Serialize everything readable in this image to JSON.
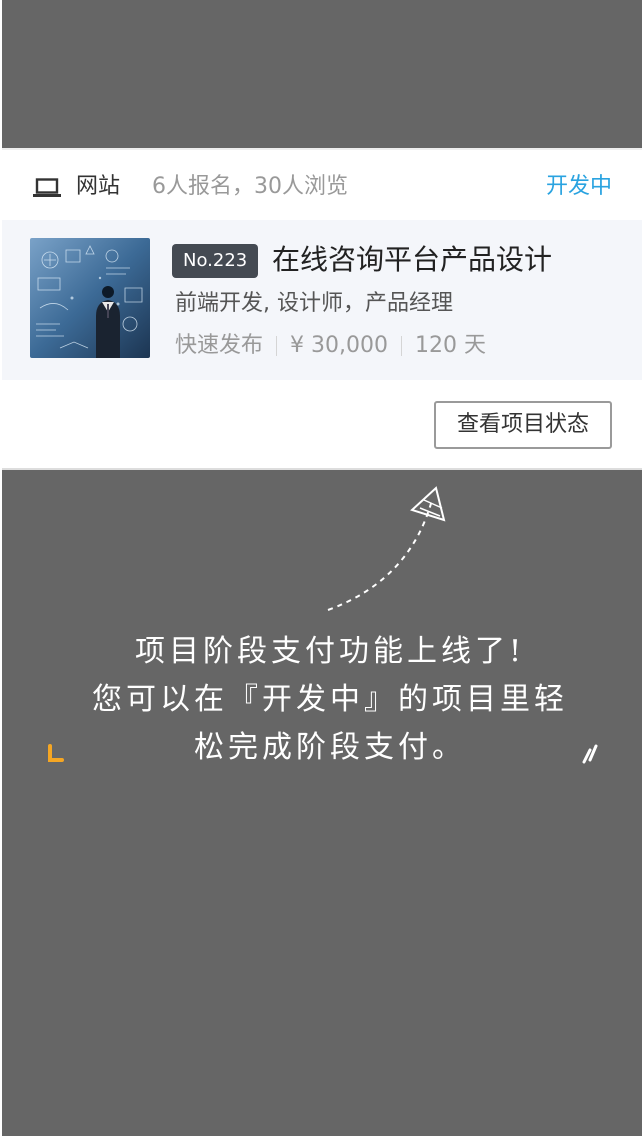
{
  "card": {
    "category": "网站",
    "stats": "6人报名，30人浏览",
    "status": "开发中",
    "project": {
      "number": "No.223",
      "title": "在线咨询平台产品设计",
      "roles": "前端开发, 设计师，产品经理",
      "publish_type": "快速发布",
      "price": "¥ 30,000",
      "duration": "120 天"
    },
    "view_button": "查看项目状态"
  },
  "announcement": {
    "line1": "项目阶段支付功能上线了!",
    "line2": "您可以在『开发中』的项目里轻",
    "line3": "松完成阶段支付。"
  },
  "icons": {
    "category_icon": "laptop-icon",
    "arrow": "dashed-arrow-icon"
  },
  "colors": {
    "background": "#666666",
    "status_blue": "#2aa3e0",
    "badge": "#444a52",
    "accent_orange": "#f5a623"
  }
}
